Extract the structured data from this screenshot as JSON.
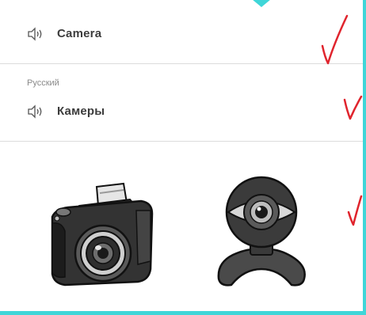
{
  "entry_original": {
    "word": "Camera",
    "audio_icon": "speaker-icon"
  },
  "entry_translation": {
    "language": "Русский",
    "word": "Камеры",
    "audio_icon": "speaker-icon"
  },
  "annotations": {
    "marks": [
      "checkmark",
      "checkmark",
      "checkmark"
    ],
    "mark_color": "#e0242d"
  },
  "images": [
    "photo-camera-icon",
    "webcam-icon"
  ],
  "colors": {
    "border": "#3fd6d8",
    "card": "#ffffff",
    "text": "#3c3c3c",
    "muted": "#8a8a8a"
  }
}
